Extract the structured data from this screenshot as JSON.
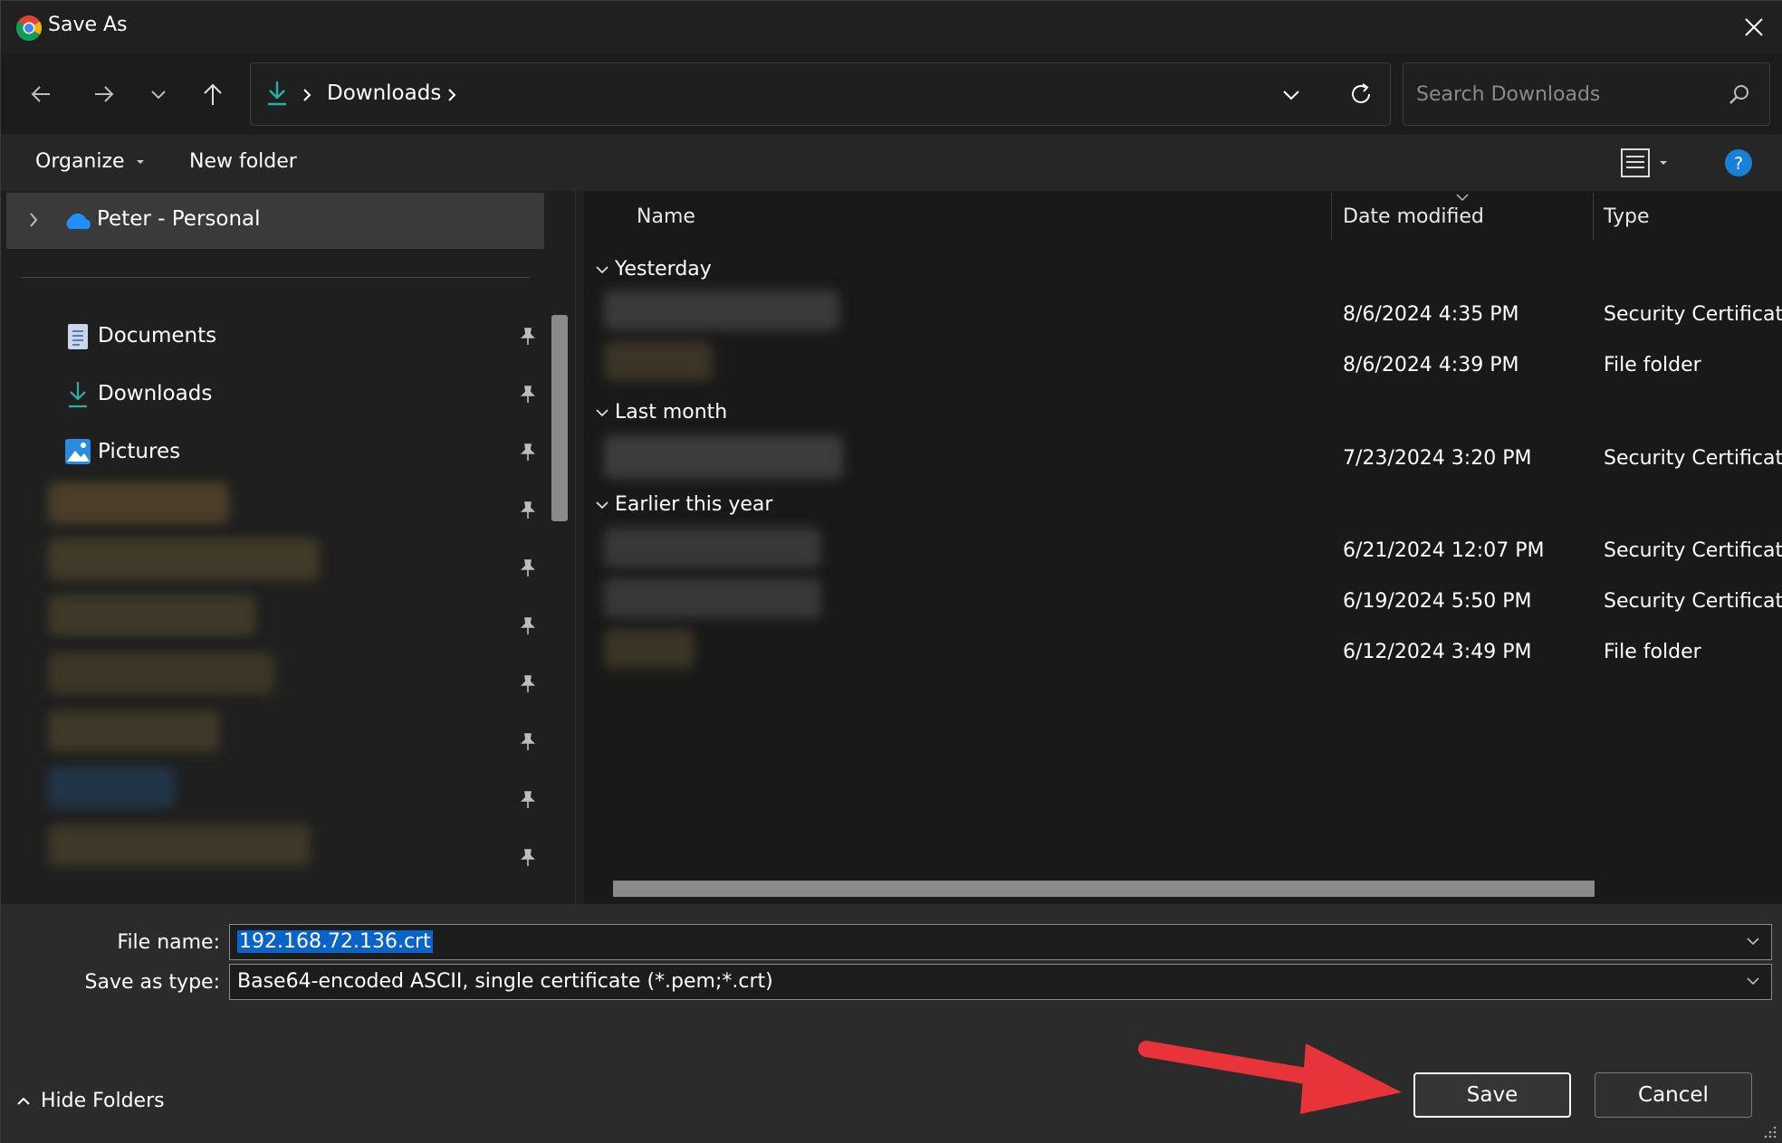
{
  "window": {
    "title": "Save As",
    "accent": "#0a64c8"
  },
  "nav": {
    "back_icon": "arrow-left-icon",
    "forward_icon": "arrow-right-icon",
    "recent_icon": "chevron-down-icon",
    "up_icon": "arrow-up-icon"
  },
  "address": {
    "location": "Downloads",
    "separator": "›"
  },
  "search": {
    "placeholder": "Search Downloads"
  },
  "toolbar": {
    "organize_label": "Organize",
    "new_folder_label": "New folder"
  },
  "sidebar": {
    "top_item": "Peter - Personal",
    "quick_access": [
      {
        "label": "Documents",
        "icon": "documents-icon"
      },
      {
        "label": "Downloads",
        "icon": "download-icon"
      },
      {
        "label": "Pictures",
        "icon": "pictures-icon"
      }
    ]
  },
  "columns": {
    "name": "Name",
    "date": "Date modified",
    "type": "Type"
  },
  "groups": [
    {
      "label": "Yesterday",
      "rows": [
        {
          "date": "8/6/2024 4:35 PM",
          "type": "Security Certificate"
        },
        {
          "date": "8/6/2024 4:39 PM",
          "type": "File folder"
        }
      ]
    },
    {
      "label": "Last month",
      "rows": [
        {
          "date": "7/23/2024 3:20 PM",
          "type": "Security Certificate"
        }
      ]
    },
    {
      "label": "Earlier this year",
      "rows": [
        {
          "date": "6/21/2024 12:07 PM",
          "type": "Security Certificate"
        },
        {
          "date": "6/19/2024 5:50 PM",
          "type": "Security Certificate"
        },
        {
          "date": "6/12/2024 3:49 PM",
          "type": "File folder"
        }
      ]
    }
  ],
  "form": {
    "file_name_label": "File name:",
    "file_name_value": "192.168.72.136.crt",
    "save_type_label": "Save as type:",
    "save_type_value": "Base64-encoded ASCII, single certificate (*.pem;*.crt)"
  },
  "buttons": {
    "save": "Save",
    "cancel": "Cancel",
    "hide_folders": "Hide Folders"
  }
}
